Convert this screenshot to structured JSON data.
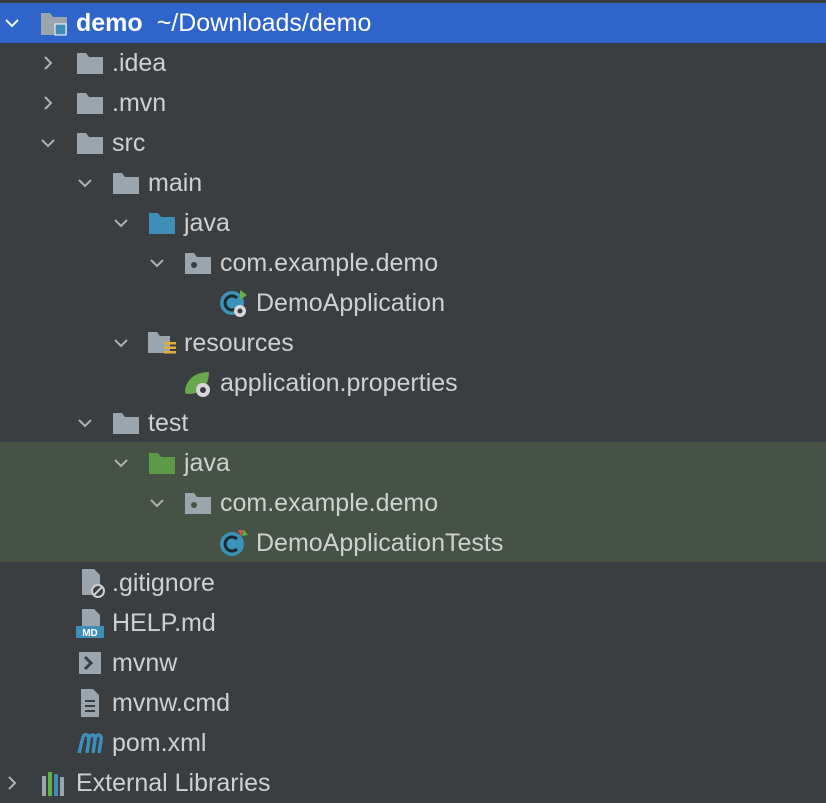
{
  "project": {
    "name": "demo",
    "path": "~/Downloads/demo"
  },
  "nodes": [
    {
      "label": ".idea"
    },
    {
      "label": ".mvn"
    },
    {
      "label": "src"
    },
    {
      "label": "main"
    },
    {
      "label": "java"
    },
    {
      "label": "com.example.demo"
    },
    {
      "label": "DemoApplication"
    },
    {
      "label": "resources"
    },
    {
      "label": "application.properties"
    },
    {
      "label": "test"
    },
    {
      "label": "java"
    },
    {
      "label": "com.example.demo"
    },
    {
      "label": "DemoApplicationTests"
    },
    {
      "label": ".gitignore"
    },
    {
      "label": "HELP.md"
    },
    {
      "label": "mvnw"
    },
    {
      "label": "mvnw.cmd"
    },
    {
      "label": "pom.xml"
    },
    {
      "label": "External Libraries"
    }
  ],
  "colors": {
    "background": "#3b3e40",
    "selection": "#2f65ca",
    "test_highlight": "#465246",
    "folder": "#9aa5ad",
    "source_folder": "#3e8fb7",
    "test_folder": "#5c9a48",
    "class_icon": "#3c93ba",
    "spring_green": "#6aa84f"
  }
}
